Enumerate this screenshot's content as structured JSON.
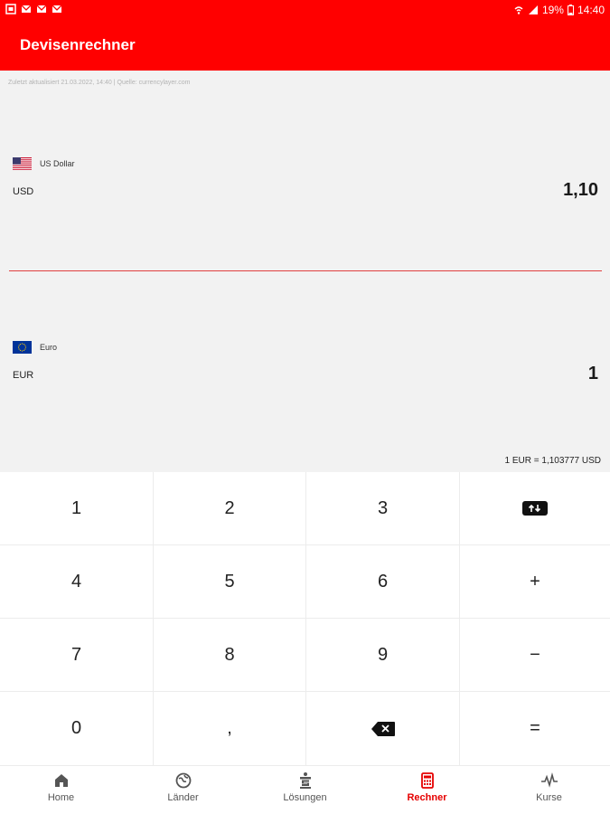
{
  "status_bar": {
    "battery": "19%",
    "time": "14:40"
  },
  "header": {
    "title": "Devisenrechner"
  },
  "converter": {
    "updated_text": "Zuletzt aktualisiert 21.03.2022, 14:40 | Quelle: currencylayer.com",
    "top": {
      "name": "US Dollar",
      "code": "USD",
      "value": "1,10",
      "flag_icon": "us-flag-icon"
    },
    "bottom": {
      "name": "Euro",
      "code": "EUR",
      "value": "1",
      "flag_icon": "eu-flag-icon"
    },
    "rate_text": "1 EUR = 1,103777 USD",
    "divider_color": "#e04040"
  },
  "keypad": {
    "keys": [
      "1",
      "2",
      "3",
      "4",
      "5",
      "6",
      "+",
      "7",
      "8",
      "9",
      "−",
      "0",
      ",",
      "="
    ],
    "swap_icon": "swap-currencies-icon",
    "backspace_icon": "backspace-icon"
  },
  "nav": {
    "items": [
      {
        "label": "Home",
        "icon": "home-icon"
      },
      {
        "label": "Länder",
        "icon": "globe-icon"
      },
      {
        "label": "Lösungen",
        "icon": "sparkasse-icon"
      },
      {
        "label": "Rechner",
        "icon": "calculator-icon"
      },
      {
        "label": "Kurse",
        "icon": "chart-pulse-icon"
      }
    ],
    "active_index": 3
  },
  "colors": {
    "brand": "#ff0000",
    "active_nav": "#e60000",
    "panel_bg": "#f2f2f2"
  }
}
